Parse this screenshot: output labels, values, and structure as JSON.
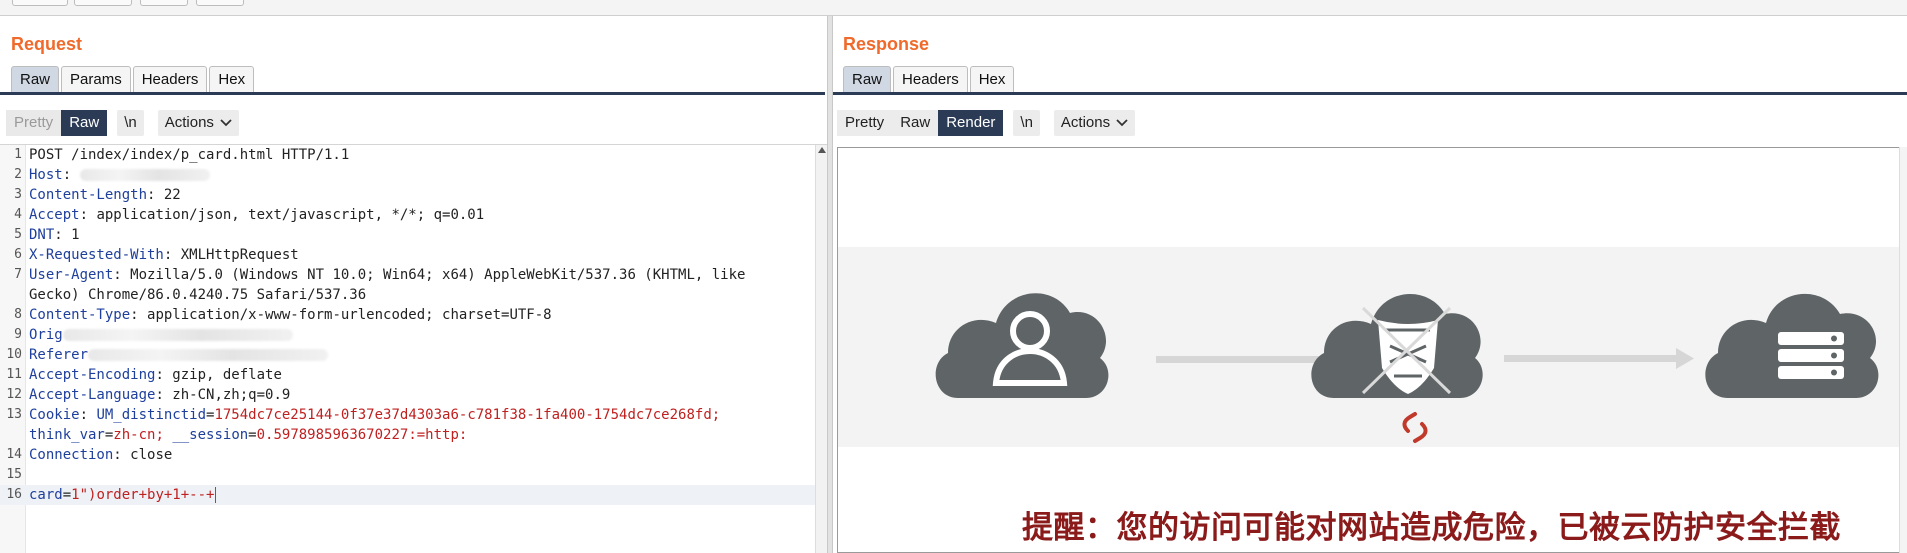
{
  "request": {
    "title": "Request",
    "tabs": [
      "Raw",
      "Params",
      "Headers",
      "Hex"
    ],
    "active_tab": "Raw",
    "toolbar": {
      "pretty": "Pretty",
      "raw": "Raw",
      "newline": "\\n",
      "actions": "Actions"
    },
    "lines": [
      {
        "num": "1",
        "key": "",
        "sep": "",
        "value": "POST /index/index/p_card.html HTTP/1.1"
      },
      {
        "num": "2",
        "key": "Host",
        "sep": ": ",
        "value": ""
      },
      {
        "num": "3",
        "key": "Content-Length",
        "sep": ": ",
        "value": "22"
      },
      {
        "num": "4",
        "key": "Accept",
        "sep": ": ",
        "value": "application/json, text/javascript, */*; q=0.01"
      },
      {
        "num": "5",
        "key": "DNT",
        "sep": ": ",
        "value": "1"
      },
      {
        "num": "6",
        "key": "X-Requested-With",
        "sep": ": ",
        "value": "XMLHttpRequest"
      },
      {
        "num": "7",
        "key": "User-Agent",
        "sep": ": ",
        "value": "Mozilla/5.0 (Windows NT 10.0; Win64; x64) AppleWebKit/537.36 (KHTML, like"
      },
      {
        "num": "",
        "key": "",
        "sep": "",
        "value": "Gecko) Chrome/86.0.4240.75 Safari/537.36"
      },
      {
        "num": "8",
        "key": "Content-Type",
        "sep": ": ",
        "value": "application/x-www-form-urlencoded; charset=UTF-8"
      },
      {
        "num": "9",
        "key": "Orig",
        "sep": "",
        "value": ""
      },
      {
        "num": "10",
        "key": "Referer",
        "sep": "",
        "value": ""
      },
      {
        "num": "11",
        "key": "Accept-Encoding",
        "sep": ": ",
        "value": "gzip, deflate"
      },
      {
        "num": "12",
        "key": "Accept-Language",
        "sep": ": ",
        "value": "zh-CN,zh;q=0.9"
      },
      {
        "num": "13",
        "key": "Cookie",
        "sep": ": ",
        "value": ""
      },
      {
        "num": "",
        "key": "",
        "sep": "",
        "value": ""
      },
      {
        "num": "14",
        "key": "Connection",
        "sep": ": ",
        "value": "close"
      },
      {
        "num": "15",
        "key": "",
        "sep": "",
        "value": ""
      },
      {
        "num": "16",
        "key": "",
        "sep": "",
        "value": ""
      }
    ],
    "cookie": {
      "k1": "UM_distinctid",
      "v1": "1754dc7ce25144-0f37e37d4303a6-c781f38-1fa400-1754dc7ce268fd;",
      "k2": "think_var",
      "v2": "zh-cn;",
      "k3": "__session",
      "v3": "0.5978985963670227:=http:"
    },
    "body": {
      "key": "card",
      "value": "1\")order+by+1+--+"
    }
  },
  "response": {
    "title": "Response",
    "tabs": [
      "Raw",
      "Headers",
      "Hex"
    ],
    "active_tab": "Raw",
    "toolbar": {
      "pretty": "Pretty",
      "raw": "Raw",
      "render": "Render",
      "newline": "\\n",
      "actions": "Actions"
    },
    "alert_text": "提醒：您的访问可能对网站造成危险，已被云防护安全拦截"
  },
  "colors": {
    "accent_orange": "#ef6a2b",
    "header_key": "#1e3f9c",
    "cookie_value": "#bf2020",
    "active_button": "#2b3a55",
    "alert": "#8b1a1a",
    "cloud": "#5f6466"
  },
  "icons": [
    "layout-split-icon",
    "layout-stack-icon",
    "layout-tabs-icon",
    "chevron-down-icon",
    "user-icon",
    "shield-icon",
    "server-icon",
    "broken-link-icon"
  ]
}
